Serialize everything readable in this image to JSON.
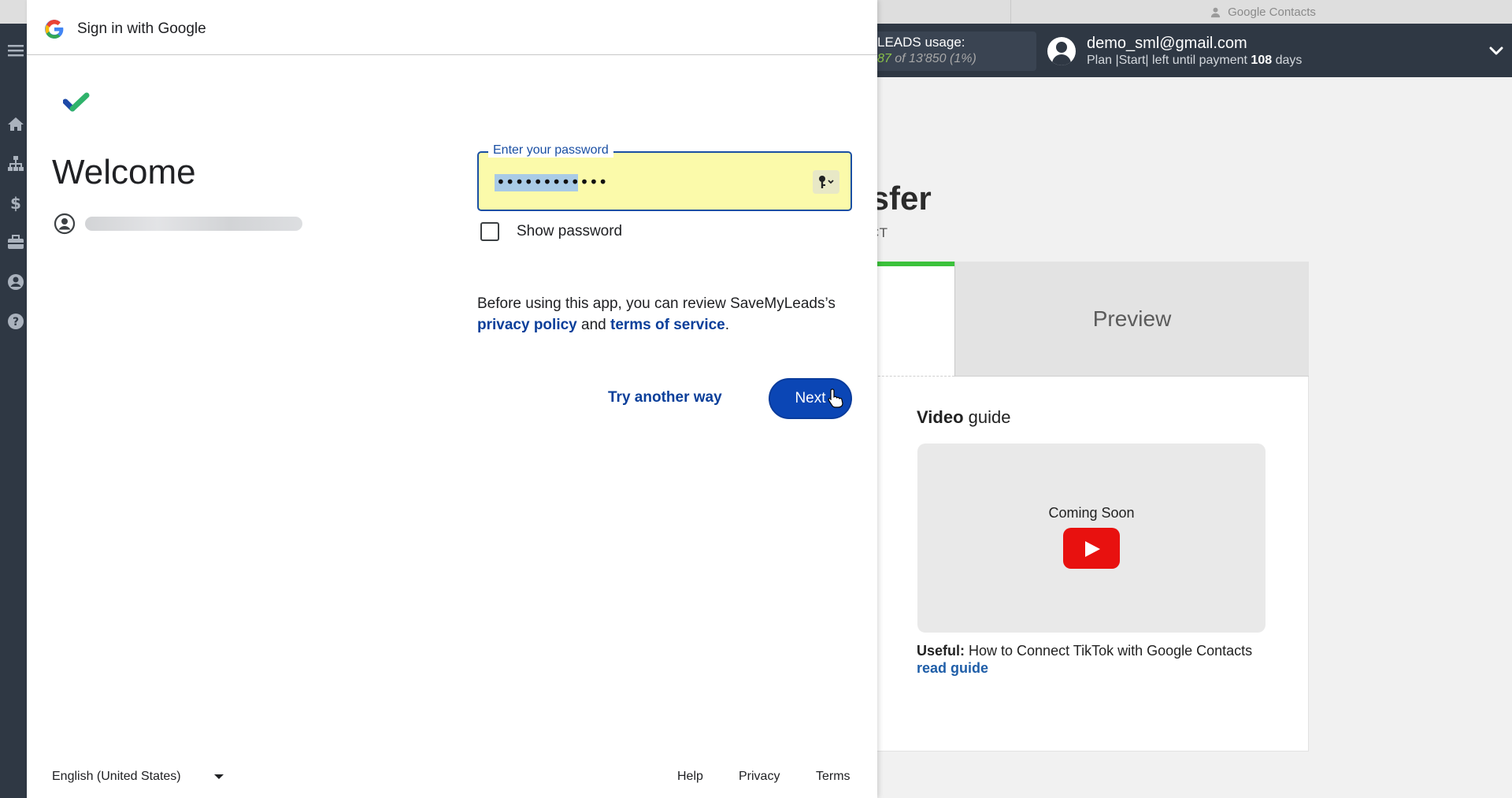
{
  "browser": {
    "tab_title": "Google Contacts"
  },
  "app": {
    "usage_label": "LEADS usage:",
    "usage_used": "87",
    "usage_rest": " of 13'850 (1%)",
    "account_email": "demo_sml@gmail.com",
    "account_plan_prefix": "Plan |Start| left until payment ",
    "account_plan_days": "108",
    "account_plan_suffix": " days",
    "page_title": "nsfer",
    "page_subtitle": "ACT",
    "preview_tab": "Preview",
    "video_guide_bold": "Video",
    "video_guide_rest": " guide",
    "coming_soon": "Coming Soon",
    "useful_label": "Useful:",
    "useful_text": " How to Connect TikTok with Google Contacts",
    "read_guide": "read guide",
    "sidebar_icons": [
      "menu-icon",
      "home-icon",
      "sitemap-icon",
      "dollar-icon",
      "briefcase-icon",
      "user-icon",
      "help-icon"
    ]
  },
  "signin": {
    "window_title": "Sign in with Google",
    "welcome": "Welcome",
    "password_label": "Enter your password",
    "password_mask": "••••••••••••",
    "show_password": "Show password",
    "review_prefix": "Before using this app, you can review SaveMyLeads’s",
    "privacy_policy": "privacy policy",
    "and": " and ",
    "terms_of_service": "terms of service",
    "period": ".",
    "try_another_way": "Try another way",
    "next": "Next",
    "language": "English (United States)",
    "footer_help": "Help",
    "footer_privacy": "Privacy",
    "footer_terms": "Terms"
  },
  "colors": {
    "google_blue": "#0b46b5",
    "link_blue": "#0b3f9a",
    "autofill_yellow": "#fbfaaa",
    "app_dark": "#2f3844",
    "progress_green": "#3cc23c",
    "youtube_red": "#e8110f"
  }
}
